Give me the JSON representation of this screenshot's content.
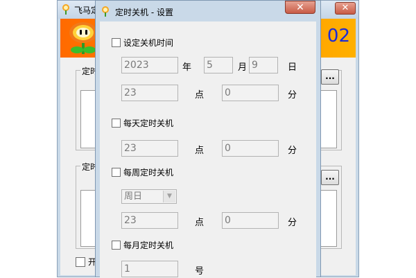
{
  "main_window": {
    "title": "飞马定",
    "close_glyph": "✕",
    "banner_text": "02",
    "group1_label": "定时",
    "group2_label": "定时",
    "browse_button_label": "...",
    "startup_checkbox_label": "开",
    "startup_checked": false
  },
  "dialog": {
    "title": "定时关机 - 设置",
    "close_glyph": "✕",
    "specific_time": {
      "label": "设定关机时间",
      "checked": false,
      "year": "2023",
      "year_unit": "年",
      "month": "5",
      "month_unit": "月",
      "day": "9",
      "day_unit": "日",
      "hour": "23",
      "hour_unit": "点",
      "minute": "0",
      "minute_unit": "分"
    },
    "daily": {
      "label": "每天定时关机",
      "checked": false,
      "hour": "23",
      "hour_unit": "点",
      "minute": "0",
      "minute_unit": "分"
    },
    "weekly": {
      "label": "每周定时关机",
      "checked": false,
      "weekday_selected": "周日",
      "hour": "23",
      "hour_unit": "点",
      "minute": "0",
      "minute_unit": "分"
    },
    "monthly": {
      "label": "每月定时关机",
      "checked": false,
      "date": "1",
      "date_unit": "号"
    }
  }
}
